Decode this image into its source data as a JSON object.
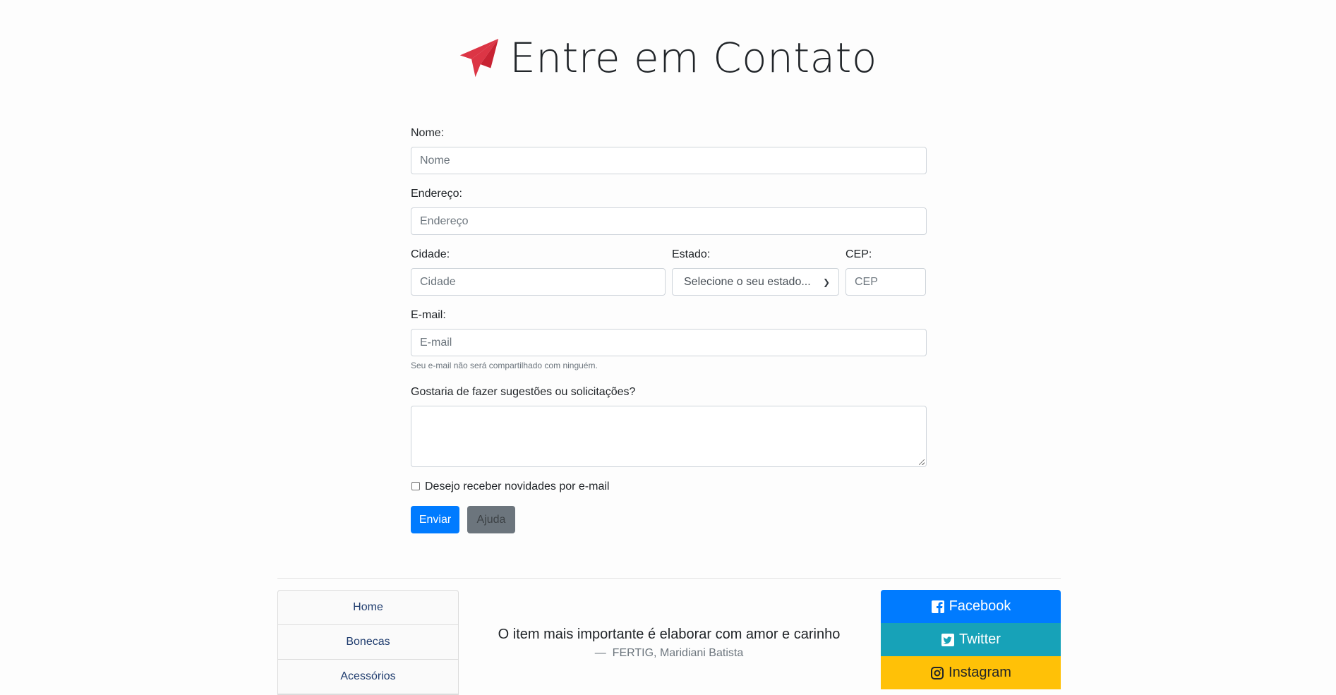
{
  "header": {
    "title": "Entre em Contato",
    "icon": "paper-plane-icon",
    "icon_color": "#dc3545"
  },
  "form": {
    "nome": {
      "label": "Nome:",
      "placeholder": "Nome"
    },
    "endereco": {
      "label": "Endereço:",
      "placeholder": "Endereço"
    },
    "cidade": {
      "label": "Cidade:",
      "placeholder": "Cidade"
    },
    "estado": {
      "label": "Estado:",
      "selected": "Selecione o seu estado..."
    },
    "cep": {
      "label": "CEP:",
      "placeholder": "CEP"
    },
    "email": {
      "label": "E-mail:",
      "placeholder": "E-mail",
      "help": "Seu e-mail não será compartilhado com ninguém."
    },
    "sugestoes": {
      "label": "Gostaria de fazer sugestões ou solicitações?"
    },
    "newsletter": {
      "label": "Desejo receber novidades por e-mail",
      "checked": false
    },
    "submit_label": "Enviar",
    "help_label": "Ajuda"
  },
  "footer": {
    "nav": [
      "Home",
      "Bonecas",
      "Acessórios"
    ],
    "quote": {
      "text": "O item mais importante é elaborar com amor e carinho",
      "author": "FERTIG, Maridiani Batista"
    },
    "social": [
      {
        "label": "Facebook",
        "icon": "facebook-icon",
        "color": "#007bff"
      },
      {
        "label": "Twitter",
        "icon": "twitter-icon",
        "color": "#17a2b8"
      },
      {
        "label": "Instagram",
        "icon": "instagram-icon",
        "color": "#ffc107"
      }
    ]
  }
}
